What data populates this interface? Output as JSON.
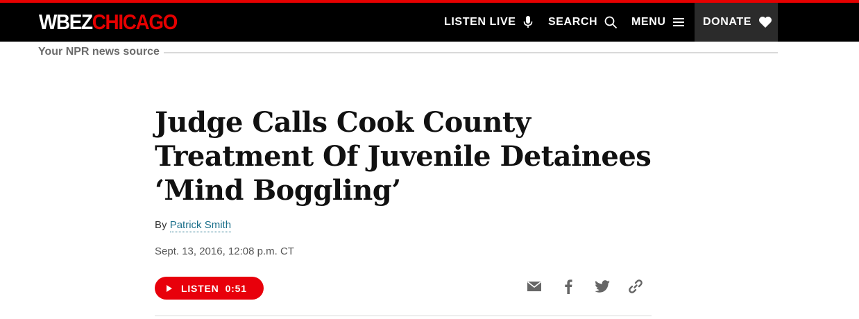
{
  "header": {
    "logo": {
      "part1": "WBEZ",
      "part2": "CHICAGO"
    },
    "nav": [
      {
        "label": "LISTEN LIVE",
        "icon": "microphone-icon"
      },
      {
        "label": "SEARCH",
        "icon": "search-icon"
      },
      {
        "label": "MENU",
        "icon": "hamburger-menu-icon"
      },
      {
        "label": "DONATE",
        "icon": "heart-icon"
      }
    ],
    "tagline": "Your NPR news source"
  },
  "article": {
    "headline": "Judge Calls Cook County Treatment Of Juvenile Detainees ‘Mind Boggling’",
    "byline_prefix": "By",
    "author": "Patrick Smith",
    "date": "Sept. 13, 2016, 12:08 p.m. CT"
  },
  "audio": {
    "label": "LISTEN",
    "duration": "0:51"
  },
  "share": [
    {
      "icon": "email-icon"
    },
    {
      "icon": "facebook-icon"
    },
    {
      "icon": "twitter-icon"
    },
    {
      "icon": "link-icon"
    }
  ],
  "colors": {
    "brand_red": "#e60000",
    "topbar": "#000000",
    "donate_bg": "#2b2b2b",
    "link": "#1a6f8a",
    "share_icon": "#666666"
  }
}
